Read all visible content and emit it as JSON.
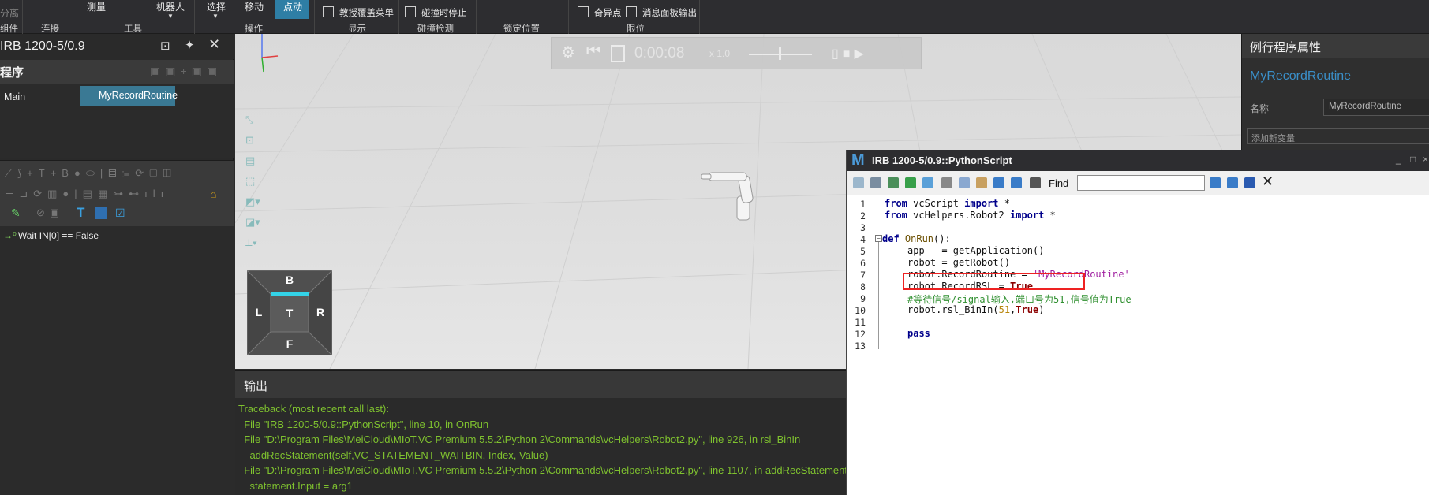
{
  "ribbon": {
    "labels": {
      "separate": "分离",
      "measure": "测量",
      "robot": "机器人",
      "select": "选择",
      "move": "移动",
      "jog": "点动",
      "teach_menu": "教授覆盖菜单",
      "stop_on_collision": "碰撞时停止",
      "singularity": "奇异点",
      "message_output": "消息面板输出"
    },
    "groups": {
      "parts": "组件",
      "connect": "连接",
      "tools": "工具",
      "operate": "操作",
      "display": "显示",
      "collision": "碰撞检测",
      "lock": "锁定位置",
      "limits": "限位"
    }
  },
  "left_panel": {
    "title": "IRB 1200-5/0.9",
    "section": "程序",
    "tabs": [
      "Main",
      "MyRecordRoutine"
    ],
    "statement": "Wait IN[0] == False"
  },
  "sim_bar": {
    "time": "0:00:08",
    "speed": "x 1.0"
  },
  "viewcube": {
    "top": "B",
    "left": "L",
    "center": "T",
    "right": "R",
    "bottom": "F"
  },
  "output": {
    "title": "输出",
    "lines": [
      "Traceback (most recent call last):",
      "  File \"IRB 1200-5/0.9::PythonScript\", line 10, in OnRun",
      "  File \"D:\\Program Files\\MeiCloud\\MIoT.VC Premium 5.5.2\\Python 2\\Commands\\vcHelpers\\Robot2.py\", line 926, in rsl_BinIn",
      "    addRecStatement(self,VC_STATEMENT_WAITBIN, Index, Value)",
      "  File \"D:\\Program Files\\MeiCloud\\MIoT.VC Premium 5.5.2\\Python 2\\Commands\\vcHelpers\\Robot2.py\", line 1107, in addRecStatement",
      "    statement.Input = arg1"
    ]
  },
  "properties": {
    "title": "例行程序属性",
    "routine_name": "MyRecordRoutine",
    "name_label": "名称",
    "name_value": "MyRecordRoutine",
    "add_variable": "添加新变量"
  },
  "editor": {
    "title": "IRB 1200-5/0.9::PythonScript",
    "find_label": "Find",
    "line_numbers": [
      "1",
      "2",
      "3",
      "4",
      "5",
      "6",
      "7",
      "8",
      "9",
      "10",
      "11",
      "12",
      "13"
    ],
    "code": {
      "l1_from": "from",
      "l1_mod": " vcScript ",
      "l1_import": "import",
      "l1_star": " *",
      "l2_from": "from",
      "l2_mod": " vcHelpers.Robot2 ",
      "l2_import": "import",
      "l2_star": " *",
      "l4_def": "def",
      "l4_name": " OnRun",
      "l4_rest": "():",
      "l5": "app   = getApplication()",
      "l6": "robot = getRobot()",
      "l7_a": "robot.RecordRoutine = ",
      "l7_str": "'MyRecordRoutine'",
      "l8_a": "robot.RecordRSL = ",
      "l8_kw": "True",
      "l9_comment": "#等待信号/signal输入,端口号为51,信号值为True",
      "l10_a": "robot.rsl_BinIn(",
      "l10_num": "51",
      "l10_c": ",",
      "l10_kw": "True",
      "l10_e": ")",
      "l12": "pass"
    }
  }
}
